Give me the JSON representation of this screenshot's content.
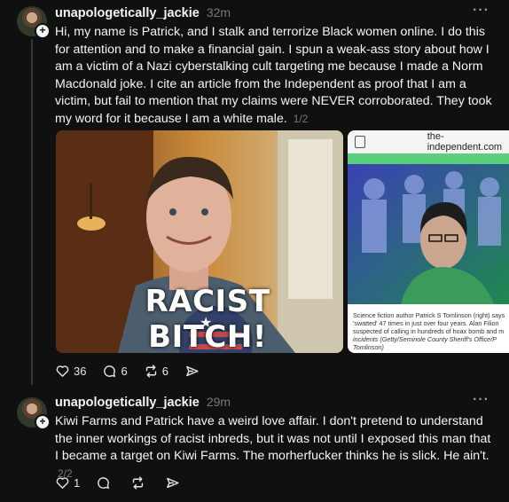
{
  "posts": [
    {
      "username": "unapologetically_jackie",
      "time": "32m",
      "text": "Hi, my name is Patrick, and I stalk and terrorize Black women online. I do this for attention and to make a financial gain. I spun a weak-ass story about how I am a victim of a Nazi cyberstalking cult targeting me because I made a Norm Macdonald joke. I cite an article from the Independent as proof that I am a victim, but fail to mention that my claims were NEVER corroborated. They took my word for it because I am a white male.",
      "pager": "1/2",
      "photo_overlay": "RACIST BITCH!",
      "article": {
        "domain": "the-independent.com",
        "caption_line1": "Science fiction author Patrick S Tomlinson (right) says",
        "caption_line2": "'swatted' 47 times in just over four years. Alan Filion",
        "caption_line3": "suspected of calling in hundreds of hoax bomb and m",
        "caption_line4": "incidents (Getty/Seminole County Sheriff's Office/P",
        "caption_line5": "Tomlinson)"
      },
      "likes": "36",
      "replies": "6",
      "reposts": "6"
    },
    {
      "username": "unapologetically_jackie",
      "time": "29m",
      "text": "Kiwi Farms and Patrick have a weird love affair. I don't pretend to understand the inner workings of racist inbreds, but it was not until I exposed this man that I became a target on Kiwi Farms. The morherfucker thinks he is slick. He ain't.",
      "pager": "2/2",
      "likes": "1"
    }
  ],
  "icons": [
    "heart-icon",
    "comment-icon",
    "repost-icon",
    "share-icon",
    "more-icon",
    "follow-plus-icon"
  ],
  "colors": {
    "background": "#101010",
    "text": "#f3f5f7",
    "muted": "#777777"
  }
}
